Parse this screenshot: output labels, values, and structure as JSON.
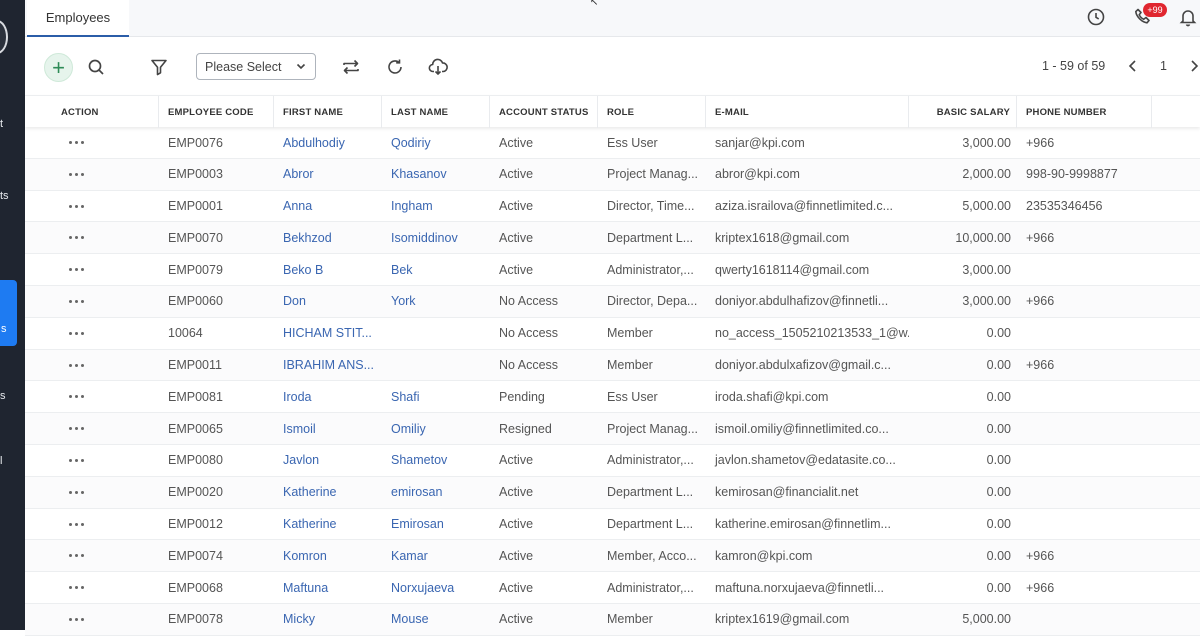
{
  "sidebar": {
    "fragments": [
      "t",
      "ts",
      "s",
      "s",
      "l"
    ],
    "active_fragment": "s"
  },
  "topbar": {
    "tab_label": "Employees",
    "notification_count": "+99"
  },
  "toolbar": {
    "select_value": "Please Select",
    "pager_range": "1 - 59 of 59",
    "pager_page": "1"
  },
  "table": {
    "headers": {
      "action": "ACTION",
      "code": "EMPLOYEE CODE",
      "first": "FIRST NAME",
      "last": "LAST NAME",
      "status": "ACCOUNT STATUS",
      "role": "ROLE",
      "email": "E-MAIL",
      "salary": "BASIC SALARY",
      "phone": "PHONE NUMBER"
    },
    "rows": [
      {
        "code": "EMP0076",
        "first": "Abdulhodiy",
        "last": "Qodiriy",
        "status": "Active",
        "role": "Ess User",
        "email": "sanjar@kpi.com",
        "salary": "3,000.00",
        "phone": "+966"
      },
      {
        "code": "EMP0003",
        "first": "Abror",
        "last": "Khasanov",
        "status": "Active",
        "role": "Project Manag...",
        "email": "abror@kpi.com",
        "salary": "2,000.00",
        "phone": "998-90-9998877"
      },
      {
        "code": "EMP0001",
        "first": "Anna",
        "last": "Ingham",
        "status": "Active",
        "role": "Director, Time...",
        "email": "aziza.israilova@finnetlimited.c...",
        "salary": "5,000.00",
        "phone": "23535346456"
      },
      {
        "code": "EMP0070",
        "first": "Bekhzod",
        "last": "Isomiddinov",
        "status": "Active",
        "role": "Department L...",
        "email": "kriptex1618@gmail.com",
        "salary": "10,000.00",
        "phone": "+966"
      },
      {
        "code": "EMP0079",
        "first": "Beko B",
        "last": "Bek",
        "status": "Active",
        "role": "Administrator,...",
        "email": "qwerty1618114@gmail.com",
        "salary": "3,000.00",
        "phone": ""
      },
      {
        "code": "EMP0060",
        "first": "Don",
        "last": "York",
        "status": "No Access",
        "role": "Director, Depa...",
        "email": "doniyor.abdulhafizov@finnetli...",
        "salary": "3,000.00",
        "phone": "+966"
      },
      {
        "code": "10064",
        "first": "HICHAM STIT...",
        "last": "",
        "status": "No Access",
        "role": "Member",
        "email": "no_access_1505210213533_1@w...",
        "salary": "0.00",
        "phone": ""
      },
      {
        "code": "EMP0011",
        "first": "IBRAHIM ANS...",
        "last": "",
        "status": "No Access",
        "role": "Member",
        "email": "doniyor.abdulxafizov@gmail.c...",
        "salary": "0.00",
        "phone": "+966"
      },
      {
        "code": "EMP0081",
        "first": "Iroda",
        "last": "Shafi",
        "status": "Pending",
        "role": "Ess User",
        "email": "iroda.shafi@kpi.com",
        "salary": "0.00",
        "phone": ""
      },
      {
        "code": "EMP0065",
        "first": "Ismoil",
        "last": "Omiliy",
        "status": "Resigned",
        "role": "Project Manag...",
        "email": "ismoil.omiliy@finnetlimited.co...",
        "salary": "0.00",
        "phone": ""
      },
      {
        "code": "EMP0080",
        "first": "Javlon",
        "last": "Shametov",
        "status": "Active",
        "role": "Administrator,...",
        "email": "javlon.shametov@edatasite.co...",
        "salary": "0.00",
        "phone": ""
      },
      {
        "code": "EMP0020",
        "first": "Katherine",
        "last": "emirosan",
        "status": "Active",
        "role": "Department L...",
        "email": "kemirosan@financialit.net",
        "salary": "0.00",
        "phone": ""
      },
      {
        "code": "EMP0012",
        "first": "Katherine",
        "last": "Emirosan",
        "status": "Active",
        "role": "Department L...",
        "email": "katherine.emirosan@finnetlim...",
        "salary": "0.00",
        "phone": ""
      },
      {
        "code": "EMP0074",
        "first": "Komron",
        "last": "Kamar",
        "status": "Active",
        "role": "Member, Acco...",
        "email": "kamron@kpi.com",
        "salary": "0.00",
        "phone": "+966"
      },
      {
        "code": "EMP0068",
        "first": "Maftuna",
        "last": "Norxujaeva",
        "status": "Active",
        "role": "Administrator,...",
        "email": "maftuna.norxujaeva@finnetli...",
        "salary": "0.00",
        "phone": "+966"
      },
      {
        "code": "EMP0078",
        "first": "Micky",
        "last": "Mouse",
        "status": "Active",
        "role": "Member",
        "email": "kriptex1619@gmail.com",
        "salary": "5,000.00",
        "phone": ""
      }
    ]
  },
  "icons": {
    "add": "plus-icon",
    "search": "search-icon",
    "filter": "filter-icon",
    "swap": "swap-icon",
    "refresh": "refresh-icon",
    "download": "cloud-download-icon",
    "clock": "clock-icon",
    "phone": "phone-icon",
    "bell": "bell-icon"
  },
  "colors": {
    "sidebar": "#1f2530",
    "sidebar_active": "#1e7bf2",
    "link": "#3a66b1",
    "badge": "#e0262f",
    "add_button": "#2e8b57"
  }
}
